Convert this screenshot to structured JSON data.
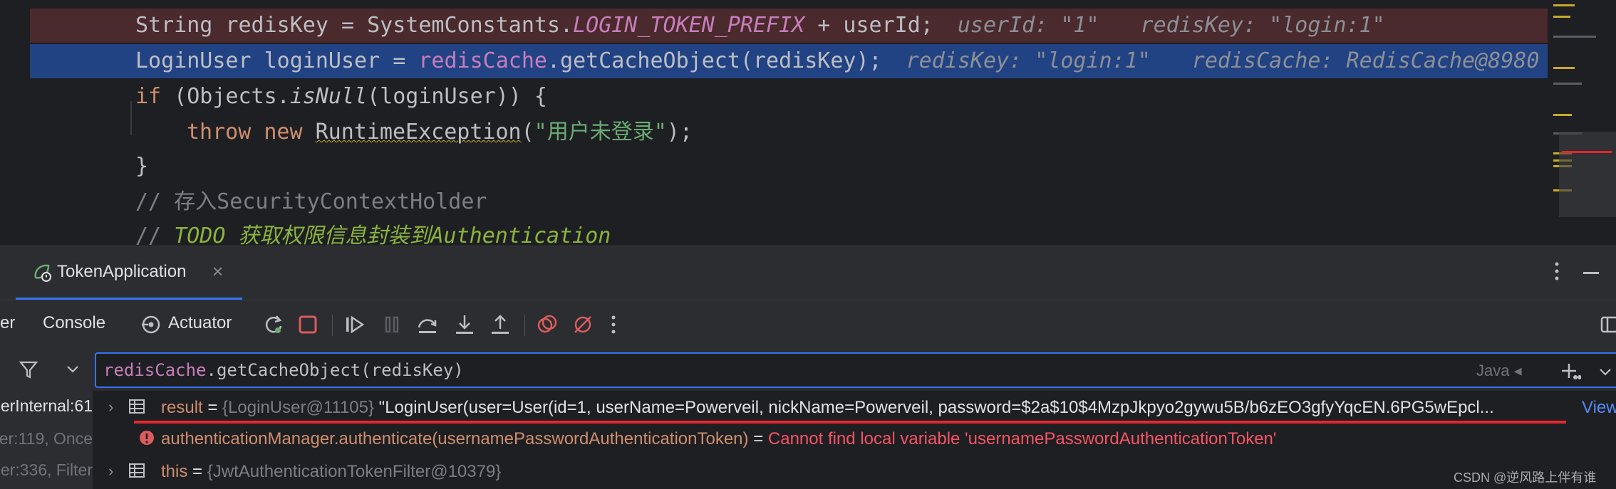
{
  "editor": {
    "lines": [
      {
        "type": "assign-prefix",
        "part1": "String redisKey = SystemConstants.",
        "constant": "LOGIN_TOKEN_PREFIX",
        "part2": " + userId;",
        "hint1": "userId: \"1\"",
        "hint2": "redisKey: \"login:1\""
      },
      {
        "type": "assign-cache",
        "part1": "LoginUser loginUser = ",
        "field": "redisCache",
        "part2": ".getCacheObject(redisKey);",
        "hint1": "redisKey: \"login:1\"",
        "hint2": "redisCache: RedisCache@8980"
      },
      {
        "kw": "if",
        "open": " (Objects.",
        "method": "isNull",
        "close": "(loginUser)) {"
      },
      {
        "kw1": "throw",
        "kw2": " new ",
        "cls": "RuntimeException",
        "paren_open": "(",
        "str": "\"用户未登录\"",
        "paren_close": ");"
      },
      {
        "text": "}"
      },
      {
        "comment": "// 存入SecurityContextHolder"
      },
      {
        "comment_prefix": "// ",
        "todo": "TODO 获取权限信息封装到Authentication"
      }
    ]
  },
  "run_panel": {
    "tab_title": "TokenApplication",
    "toolbar": {
      "debugger_label": "er",
      "console_label": "Console",
      "actuator_label": "Actuator"
    },
    "evaluate": {
      "expr_field": "redisCache",
      "expr_rest": ".getCacheObject(redisKey)",
      "language": "Java ◂"
    },
    "frames": [
      "erInternal:61",
      "er:119, Once",
      "er:336, Filter"
    ],
    "variables": [
      {
        "name": "result",
        "eq": " = ",
        "type": "{LoginUser@11105}",
        "value": " \"LoginUser(user=User(id=1, userName=Powerveil, nickName=Powerveil, password=$2a$10$4MzpJkpyo2gywu5B/b6zEO3gfyYqcEN.6PG5wEpcl...",
        "link": "View"
      },
      {
        "name": "authenticationManager.authenticate(usernamePasswordAuthenticationToken)",
        "eq": " = ",
        "error": "Cannot find local variable 'usernamePasswordAuthenticationToken'"
      },
      {
        "name": "this",
        "eq": " = ",
        "type": "{JwtAuthenticationTokenFilter@10379}"
      }
    ]
  },
  "watermark": "CSDN @逆风路上伴有谁",
  "colors": {
    "accent": "#3574f0",
    "error": "#f75464",
    "stop_button": "#db5c5c",
    "annotation_underline": "#e8262d"
  }
}
